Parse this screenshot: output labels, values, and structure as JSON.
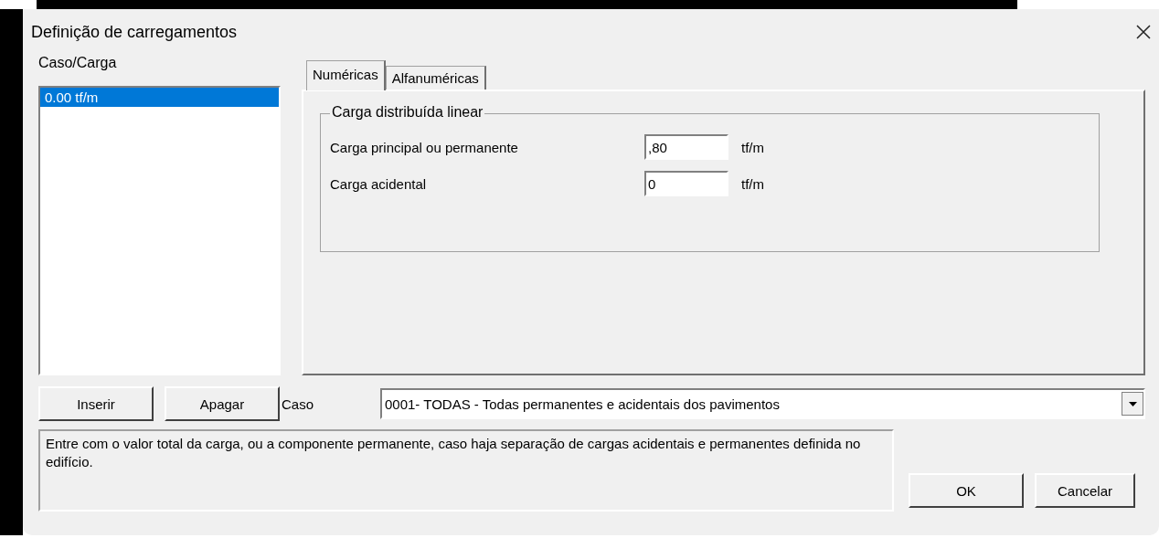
{
  "window": {
    "title": "Definição de carregamentos"
  },
  "case_list": {
    "label": "Caso/Carga",
    "items": [
      {
        "text": "0.00 tf/m",
        "selected": true
      }
    ]
  },
  "tabs": [
    {
      "label": "Numéricas",
      "selected": true
    },
    {
      "label": "Alfanuméricas",
      "selected": false
    }
  ],
  "group": {
    "title": "Carga distribuída linear",
    "fields": [
      {
        "label": "Carga principal ou permanente",
        "value": ",80",
        "unit": "tf/m"
      },
      {
        "label": "Carga acidental",
        "value": "0",
        "unit": "tf/m"
      }
    ]
  },
  "buttons": [
    "Inserir",
    "Apagar"
  ],
  "case_select": {
    "label": "Caso",
    "value": "0001- TODAS - Todas permanentes e acidentais dos pavimentos"
  },
  "help_text": "Entre com o valor total da carga, ou a componente permanente, caso haja separação de cargas acidentais e permanentes definida no edifício.",
  "dialog_buttons": [
    "OK",
    "Cancelar"
  ]
}
